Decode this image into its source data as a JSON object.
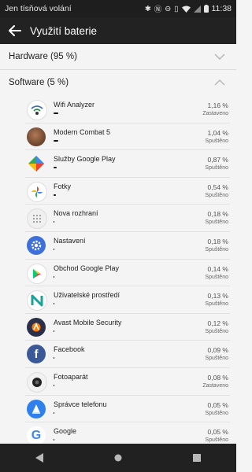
{
  "status_bar": {
    "left_text": "Jen tísňová volání",
    "time": "11:38"
  },
  "app_bar": {
    "title": "Využití baterie"
  },
  "sections": {
    "hardware": {
      "title": "Hardware (95 %)"
    },
    "software": {
      "title": "Software (5 %)"
    }
  },
  "apps": [
    {
      "name": "Wifi Analyzer",
      "percent": "1,16 %",
      "status": "Zastaveno",
      "usage_fraction": 0.05,
      "icon": "wifi-analyzer-icon"
    },
    {
      "name": "Modern Combat 5",
      "percent": "1,04 %",
      "status": "Spuštěno",
      "usage_fraction": 0.05,
      "icon": "modern-combat-icon"
    },
    {
      "name": "Služby Google Play",
      "percent": "0,87 %",
      "status": "Spuštěno",
      "usage_fraction": 0.04,
      "icon": "google-play-services-icon"
    },
    {
      "name": "Fotky",
      "percent": "0,54 %",
      "status": "Spuštěno",
      "usage_fraction": 0.03,
      "icon": "google-photos-icon"
    },
    {
      "name": "Nova rozhraní",
      "percent": "0,18 %",
      "status": "Spuštěno",
      "usage_fraction": 0.01,
      "icon": "nova-interface-icon"
    },
    {
      "name": "Nastavení",
      "percent": "0,18 %",
      "status": "Spuštěno",
      "usage_fraction": 0.01,
      "icon": "settings-gear-icon"
    },
    {
      "name": "Obchod Google Play",
      "percent": "0,14 %",
      "status": "Spuštěno",
      "usage_fraction": 0.01,
      "icon": "google-play-store-icon"
    },
    {
      "name": "Uživatelské prostředí",
      "percent": "0,13 %",
      "status": "Spuštěno",
      "usage_fraction": 0.01,
      "icon": "user-interface-icon"
    },
    {
      "name": "Avast Mobile Security",
      "percent": "0,12 %",
      "status": "Spuštěno",
      "usage_fraction": 0.01,
      "icon": "avast-icon"
    },
    {
      "name": "Facebook",
      "percent": "0,09 %",
      "status": "Spuštěno",
      "usage_fraction": 0.01,
      "icon": "facebook-icon"
    },
    {
      "name": "Fotoaparát",
      "percent": "0,08 %",
      "status": "Zastaveno",
      "usage_fraction": 0.01,
      "icon": "camera-icon"
    },
    {
      "name": "Správce telefonu",
      "percent": "0,05 %",
      "status": "Spuštěno",
      "usage_fraction": 0.005,
      "icon": "phone-manager-icon"
    },
    {
      "name": "Google",
      "percent": "0,05 %",
      "status": "Spuštěno",
      "usage_fraction": 0.005,
      "icon": "google-icon"
    }
  ],
  "navigation": {
    "back": "back-triangle-icon",
    "home": "home-circle-icon",
    "recents": "recents-square-icon"
  }
}
